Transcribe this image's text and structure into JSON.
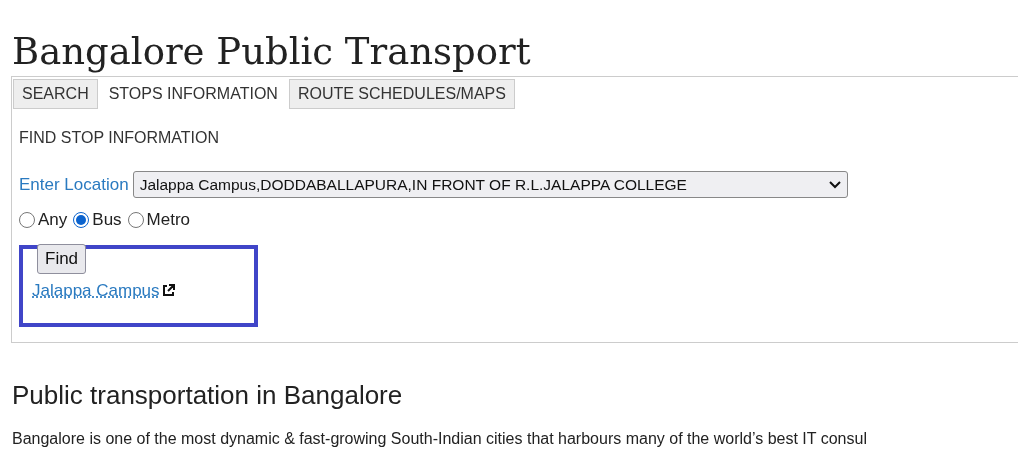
{
  "title": "Bangalore Public Transport",
  "tabs": [
    {
      "label": "SEARCH",
      "selected": false
    },
    {
      "label": "STOPS INFORMATION",
      "selected": true
    },
    {
      "label": "ROUTE SCHEDULES/MAPS",
      "selected": false
    }
  ],
  "section_heading": "FIND STOP INFORMATION",
  "location": {
    "label": "Enter Location",
    "value": "Jalappa Campus,DODDABALLAPURA,IN FRONT OF R.L.JALAPPA COLLEGE"
  },
  "modes": [
    {
      "label": "Any",
      "selected": false
    },
    {
      "label": "Bus",
      "selected": true
    },
    {
      "label": "Metro",
      "selected": false
    }
  ],
  "find_button": "Find",
  "result_link": "Jalappa Campus",
  "highlighted": true,
  "article": {
    "heading": "Public transportation in Bangalore",
    "text": "Bangalore is one of the most dynamic & fast-growing South-Indian cities that harbours many of the world’s best IT consul"
  }
}
